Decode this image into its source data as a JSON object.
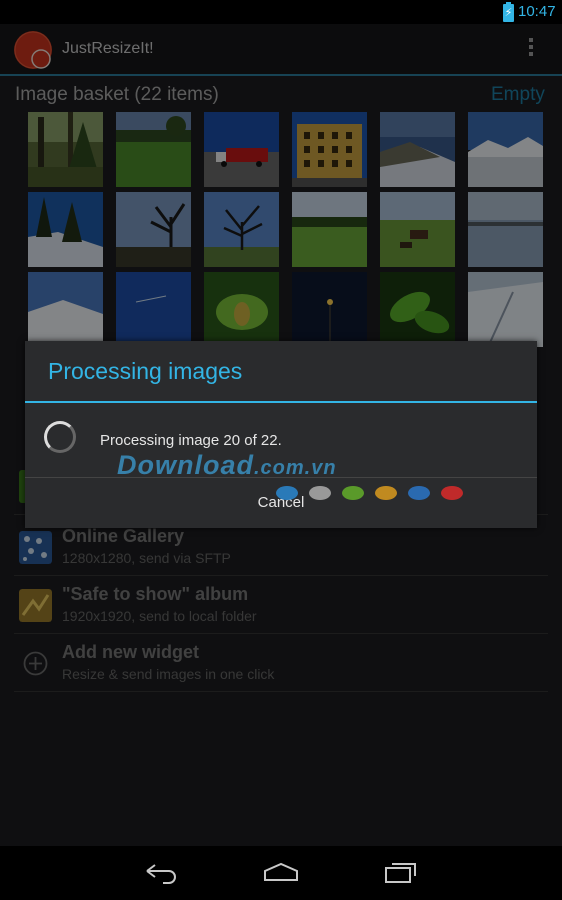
{
  "status_bar": {
    "time": "10:47",
    "battery_icon": "battery-charging-icon"
  },
  "app": {
    "title": "JustResizeIt!",
    "overflow_icon": "overflow-menu-icon"
  },
  "basket": {
    "title": "Image basket (22 items)",
    "empty_label": "Empty",
    "thumbnails": [
      "forest-photo",
      "lawn-photo",
      "red-truck-photo",
      "building-photo",
      "snowy-hill-photo",
      "mountain-photo",
      "snowy-trees-photo",
      "bare-tree-photo",
      "lone-tree-photo",
      "green-field-photo",
      "cows-field-photo",
      "lake-photo",
      "snow-slope-photo",
      "blue-sky-photo",
      "leaf-photo",
      "street-lamp-photo",
      "green-leaves-photo",
      "snow-trail-photo"
    ]
  },
  "widgets": [
    {
      "name": "",
      "desc": ""
    },
    {
      "name": "Online Gallery",
      "desc": "1280x1280, send via SFTP",
      "icon": "gallery-icon"
    },
    {
      "name": "\"Safe to show\" album",
      "desc": "1920x1920, send to local folder",
      "icon": "album-icon"
    },
    {
      "name": "Add new widget",
      "desc": "Resize & send images in one click",
      "icon": "plus-icon"
    }
  ],
  "dialog": {
    "title": "Processing images",
    "message": "Processing image 20 of 22.",
    "progress": {
      "current": 20,
      "total": 22
    },
    "cancel_label": "Cancel"
  },
  "watermark": {
    "text": "Download",
    "suffix": ".com.vn"
  },
  "nav": {
    "back_icon": "back-icon",
    "home_icon": "home-icon",
    "recents_icon": "recents-icon"
  },
  "colors": {
    "accent": "#33b5e5",
    "background": "#1c1d1f",
    "dialog": "#2a2b2d"
  }
}
